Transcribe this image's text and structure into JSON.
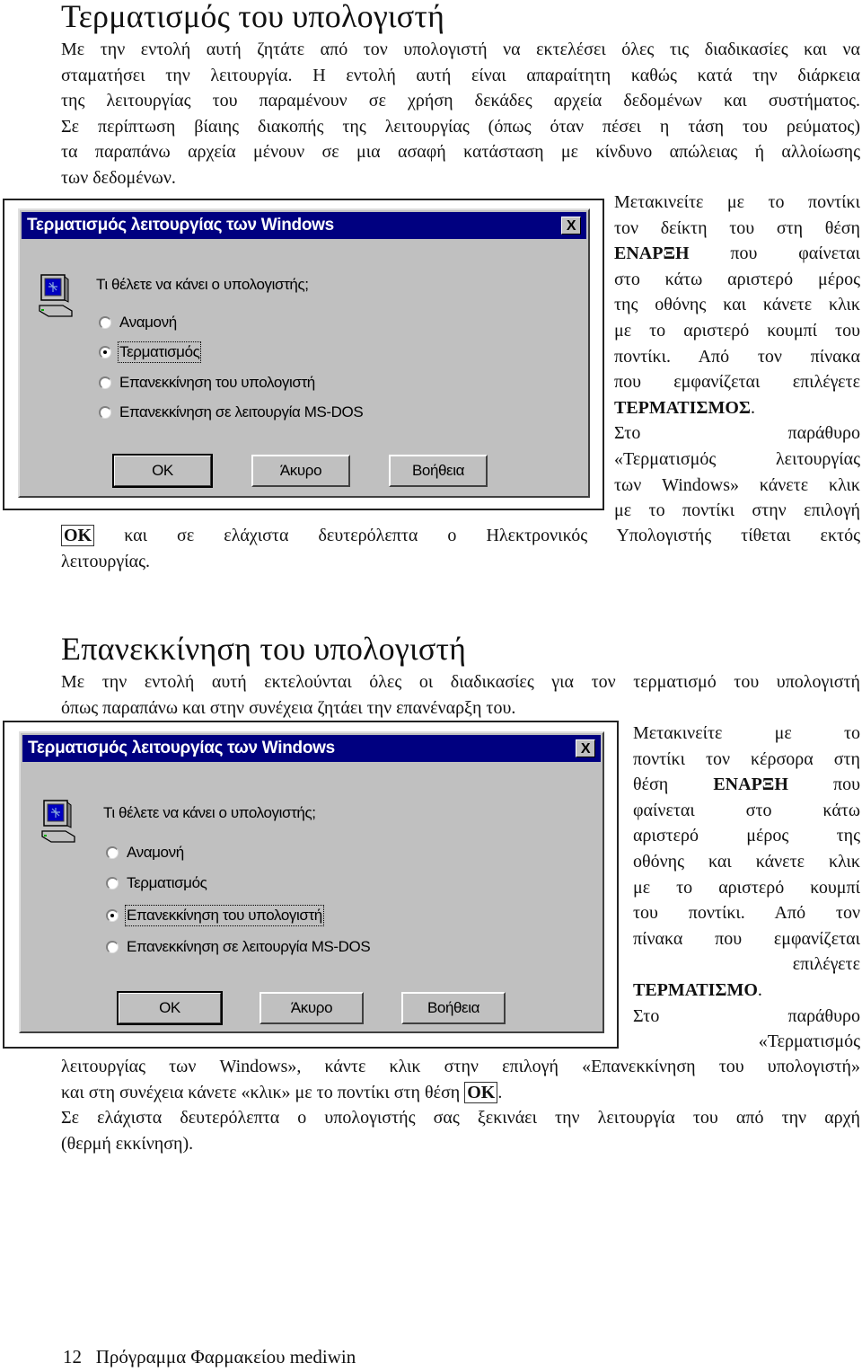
{
  "section1": {
    "heading": "Τερματισμός του υπολογιστή",
    "intro_lines": [
      "Με την εντολή αυτή ζητάτε από τον υπολογιστή να εκτελέσει όλες τις διαδικασίες και να",
      "σταματήσει την λειτουργία. Η εντολή αυτή είναι απαραίτητη καθώς κατά την διάρκεια",
      "της λειτουργίας του παραμένουν σε χρήση δεκάδες αρχεία δεδομένων και συστήματος.",
      "Σε περίπτωση βίαιης διακοπής της λειτουργίας (όπως όταν πέσει η τάση του ρεύματος)",
      "τα παραπάνω αρχεία μένουν σε μια ασαφή κατάσταση με κίνδυνο απώλειας ή αλλοίωσης",
      "των δεδομένων."
    ],
    "side_lines": [
      "Μετακινείτε με το ποντίκι",
      "τον δείκτη του στη θέση",
      "ΕΝΑΡΞΗ",
      "που φαίνεται",
      "στο κάτω αριστερό μέρος",
      "της οθόνης και κάνετε κλικ",
      "με το αριστερό κουμπί του",
      "ποντίκι. Από τον πίνακα",
      "που εμφανίζεται επιλέγετε",
      "ΤΕΡΜΑΤΙΣΜΟΣ",
      ".",
      "Στο",
      "παράθυρο",
      "«Τερματισμός λειτουργίας",
      "των Windows» κάνετε κλικ",
      "με το ποντίκι στην επιλογή"
    ],
    "ok_label": "OK",
    "after_ok_line": "και σε ελάχιστα δευτερόλεπτα ο Ηλεκτρονικός Υπολογιστής τίθεται εκτός",
    "last_line": "λειτουργίας.",
    "dialog": {
      "title": "Τερματισμός λειτουργίας των Windows",
      "close_label": "X",
      "prompt": "Τι θέλετε να κάνει ο υπολογιστής;",
      "options": [
        {
          "label": "Αναμονή",
          "checked": false
        },
        {
          "label": "Τερματισμός",
          "checked": true
        },
        {
          "label": "Επανεκκίνηση του υπολογιστή",
          "checked": false
        },
        {
          "label": "Επανεκκίνηση σε λειτουργία MS-DOS",
          "checked": false
        }
      ],
      "buttons": {
        "ok": "OK",
        "cancel": "Άκυρο",
        "help": "Βοήθεια"
      }
    }
  },
  "section2": {
    "heading": "Επανεκκίνηση του υπολογιστή",
    "intro_lines": [
      "Με την εντολή αυτή εκτελούνται όλες οι διαδικασίες για τον τερματισμό του υπολογιστή",
      "όπως παραπάνω και στην συνέχεια ζητάει την επανέναρξη του."
    ],
    "side_lines": [
      "Μετακινείτε με το",
      "ποντίκι τον κέρσορα στη",
      "θέση",
      "ΕΝΑΡΞΗ",
      "που",
      "φαίνεται στο κάτω",
      "αριστερό μέρος της",
      "οθόνης και κάνετε κλικ",
      "με το αριστερό κουμπί",
      "του ποντίκι. Από τον",
      "πίνακα που εμφανίζεται",
      "επιλέγετε",
      "ΤΕΡΜΑΤΙΣΜΟ",
      ".",
      "Στο",
      "παράθυρο",
      "«Τερματισμός"
    ],
    "tail_line1": "λειτουργίας των Windows», κάντε κλικ στην επιλογή «Επανεκκίνηση του υπολογιστή»",
    "tail_line2_pre": "και στη συνέχεια κάνετε «κλικ» με το ποντίκι στη θέση",
    "ok_label": "OK",
    "tail_line2_post": ".",
    "tail_line3": "Σε ελάχιστα δευτερόλεπτα ο υπολογιστής σας ξεκινάει την λειτουργία του από την αρχή",
    "tail_line4": "(θερμή εκκίνηση).",
    "dialog": {
      "title": "Τερματισμός λειτουργίας των Windows",
      "close_label": "X",
      "prompt": "Τι θέλετε να κάνει ο υπολογιστής;",
      "options": [
        {
          "label": "Αναμονή",
          "checked": false
        },
        {
          "label": "Τερματισμός",
          "checked": false
        },
        {
          "label": "Επανεκκίνηση του υπολογιστή",
          "checked": true
        },
        {
          "label": "Επανεκκίνηση σε λειτουργία MS-DOS",
          "checked": false
        }
      ],
      "buttons": {
        "ok": "OK",
        "cancel": "Άκυρο",
        "help": "Βοήθεια"
      }
    }
  },
  "footer": {
    "page_number": "12",
    "title": "Πρόγραμμα Φαρμακείου mediwin"
  },
  "colors": {
    "titlebar": "#000080",
    "dialog_face": "#c0c0c0"
  }
}
